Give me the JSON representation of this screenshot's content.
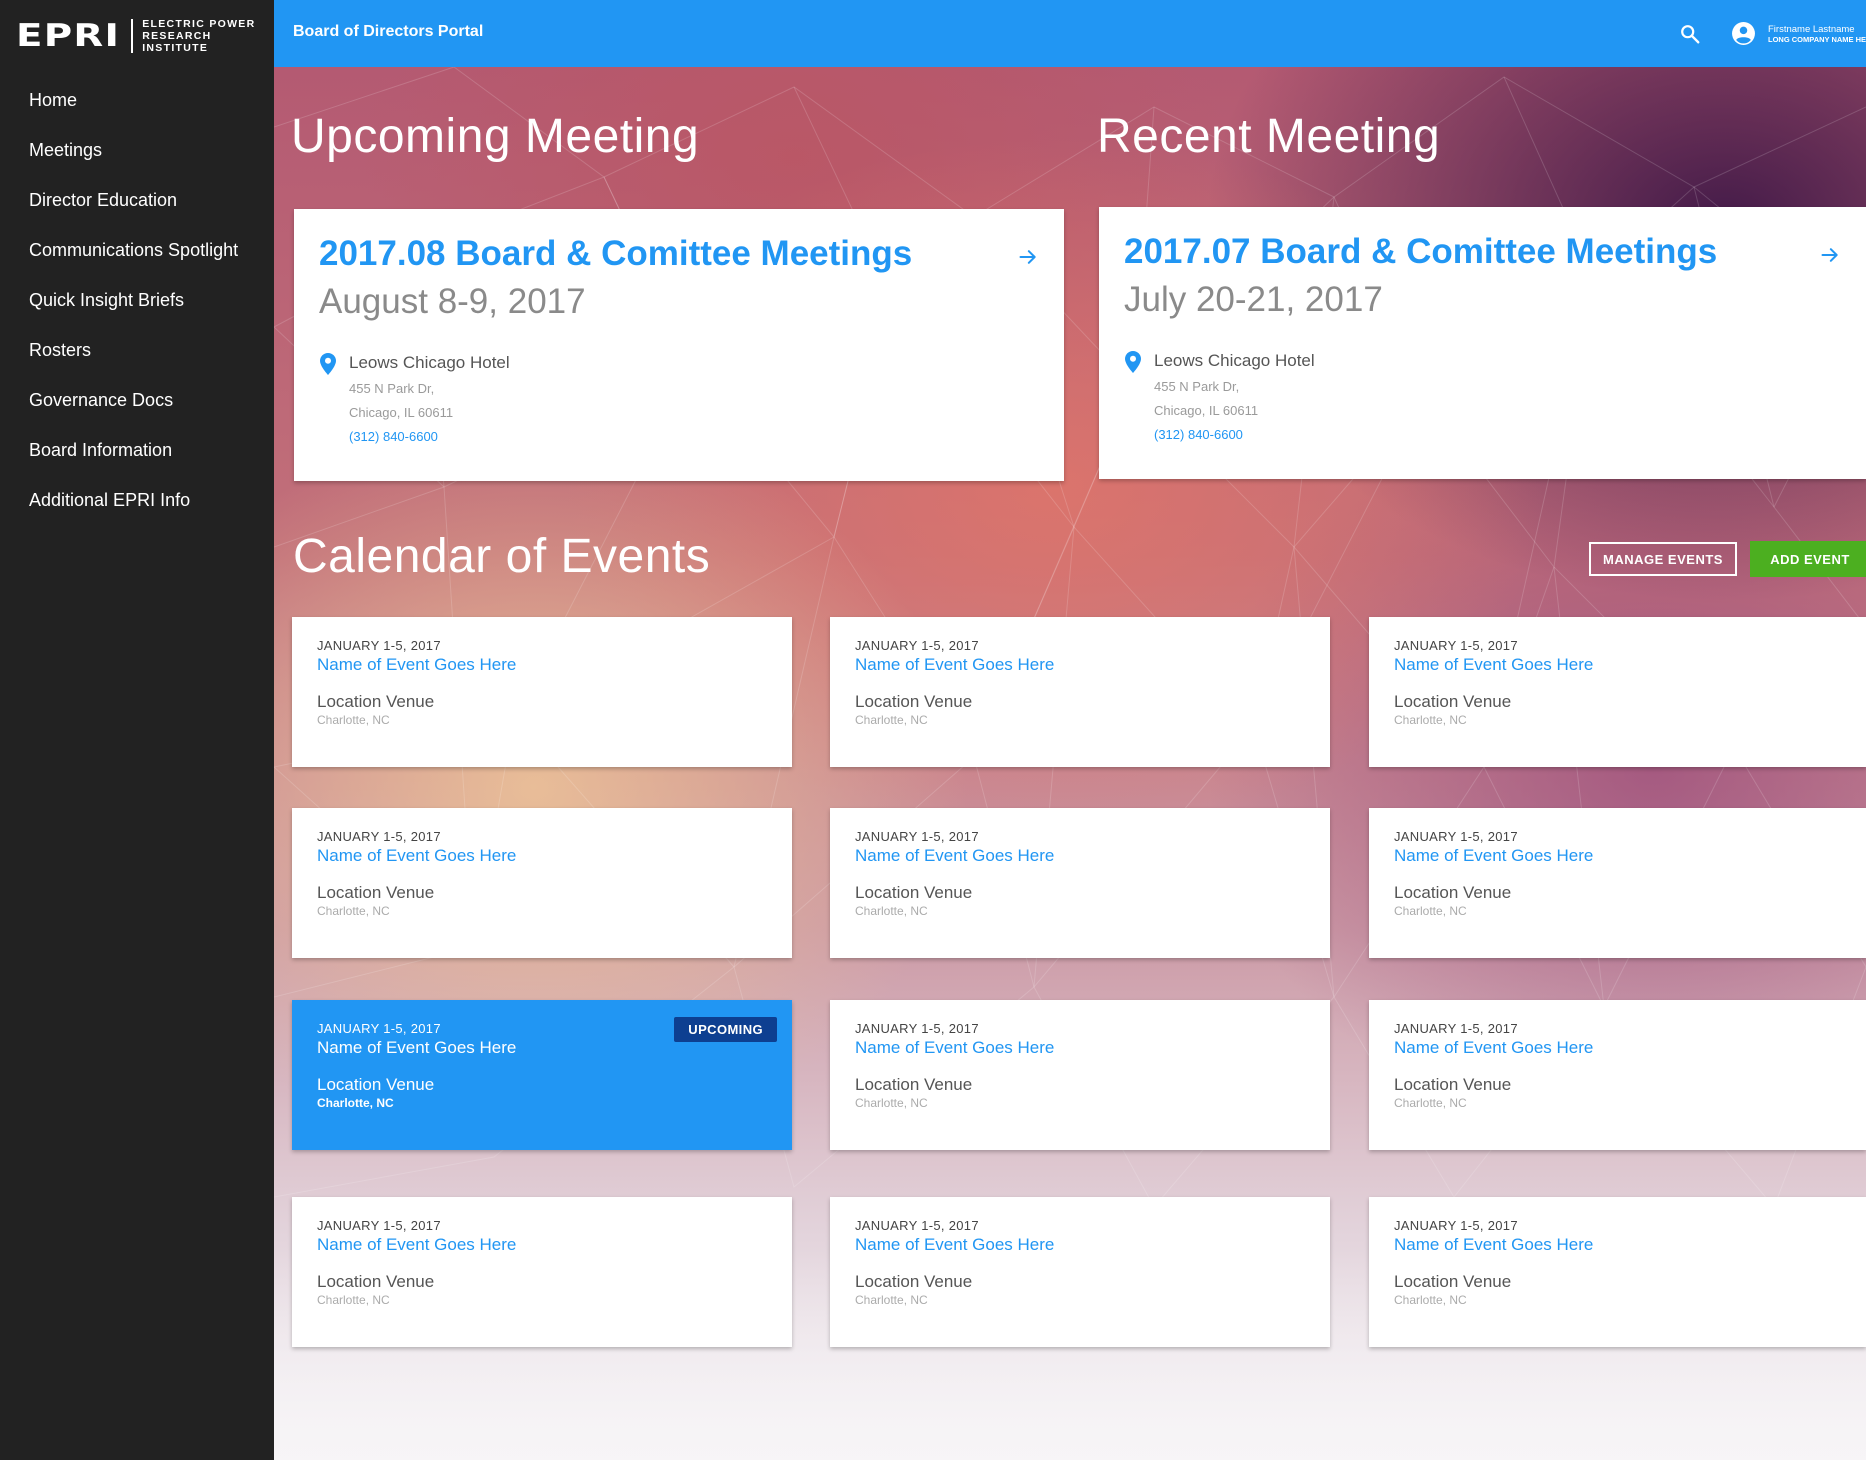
{
  "logo": {
    "mark": "EPRI",
    "line1": "ELECTRIC POWER",
    "line2": "RESEARCH INSTITUTE"
  },
  "sidebar": {
    "items": [
      {
        "label": "Home"
      },
      {
        "label": "Meetings"
      },
      {
        "label": "Director Education"
      },
      {
        "label": "Communications Spotlight"
      },
      {
        "label": "Quick Insight Briefs"
      },
      {
        "label": "Rosters"
      },
      {
        "label": "Governance Docs"
      },
      {
        "label": "Board Information"
      },
      {
        "label": "Additional EPRI Info"
      }
    ]
  },
  "header": {
    "title": "Board of Directors Portal",
    "user_name": "Firstname Lastname",
    "user_company": "LONG COMPANY NAME HE"
  },
  "upcoming": {
    "section_title": "Upcoming Meeting",
    "title": "2017.08 Board & Comittee Meetings",
    "date": "August 8-9, 2017",
    "venue": "Leows Chicago Hotel",
    "address1": "455 N Park Dr,",
    "address2": "Chicago, IL 60611",
    "phone": "(312) 840-6600"
  },
  "recent": {
    "section_title": "Recent Meeting",
    "title": "2017.07 Board & Comittee Meetings",
    "date": "July 20-21, 2017",
    "venue": "Leows Chicago Hotel",
    "address1": "455 N Park Dr,",
    "address2": "Chicago, IL 60611",
    "phone": "(312) 840-6600"
  },
  "calendar": {
    "title": "Calendar of Events",
    "manage_label": "MANAGE EVENTS",
    "add_label": "ADD EVENT",
    "upcoming_badge": "UPCOMING",
    "events": [
      {
        "date": "JANUARY 1-5, 2017",
        "name": "Name of Event Goes Here",
        "venue": "Location Venue",
        "city": "Charlotte, NC"
      },
      {
        "date": "JANUARY 1-5, 2017",
        "name": "Name of Event Goes Here",
        "venue": "Location Venue",
        "city": "Charlotte, NC"
      },
      {
        "date": "JANUARY 1-5, 2017",
        "name": "Name of Event Goes Here",
        "venue": "Location Venue",
        "city": "Charlotte, NC"
      },
      {
        "date": "JANUARY 1-5, 2017",
        "name": "Name of Event Goes Here",
        "venue": "Location Venue",
        "city": "Charlotte, NC"
      },
      {
        "date": "JANUARY 1-5, 2017",
        "name": "Name of Event Goes Here",
        "venue": "Location Venue",
        "city": "Charlotte, NC"
      },
      {
        "date": "JANUARY 1-5, 2017",
        "name": "Name of Event Goes Here",
        "venue": "Location Venue",
        "city": "Charlotte, NC"
      },
      {
        "date": "JANUARY 1-5, 2017",
        "name": "Name of Event Goes Here",
        "venue": "Location Venue",
        "city": "Charlotte, NC"
      },
      {
        "date": "JANUARY 1-5, 2017",
        "name": "Name of Event Goes Here",
        "venue": "Location Venue",
        "city": "Charlotte, NC"
      },
      {
        "date": "JANUARY 1-5, 2017",
        "name": "Name of Event Goes Here",
        "venue": "Location Venue",
        "city": "Charlotte, NC"
      },
      {
        "date": "JANUARY 1-5, 2017",
        "name": "Name of Event Goes Here",
        "venue": "Location Venue",
        "city": "Charlotte, NC"
      },
      {
        "date": "JANUARY 1-5, 2017",
        "name": "Name of Event Goes Here",
        "venue": "Location Venue",
        "city": "Charlotte, NC"
      },
      {
        "date": "JANUARY 1-5, 2017",
        "name": "Name of Event Goes Here",
        "venue": "Location Venue",
        "city": "Charlotte, NC"
      }
    ]
  },
  "colors": {
    "accent": "#2196f3",
    "sidebar": "#222222",
    "add_button": "#4caf20",
    "badge": "#0d3f91"
  },
  "icons": {
    "search": "search-icon",
    "user": "account-circle-icon",
    "arrow": "arrow-right-icon",
    "pin": "location-pin-icon"
  }
}
